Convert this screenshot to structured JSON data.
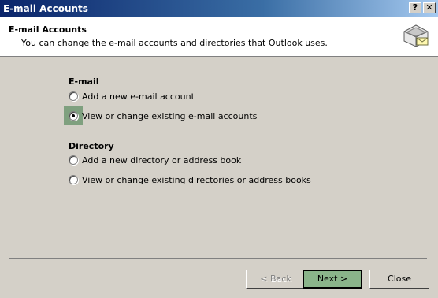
{
  "window": {
    "title": "E-mail Accounts",
    "help_label": "?",
    "close_label": "✕"
  },
  "header": {
    "title": "E-mail Accounts",
    "description": "You can change the e-mail accounts and directories that Outlook uses."
  },
  "email_group": {
    "title": "E-mail",
    "options": [
      {
        "label": "Add a new e-mail account",
        "checked": false
      },
      {
        "label": "View or change existing e-mail accounts",
        "checked": true
      }
    ]
  },
  "directory_group": {
    "title": "Directory",
    "options": [
      {
        "label": "Add a new directory or address book",
        "checked": false
      },
      {
        "label": "View or change existing directories or address books",
        "checked": false
      }
    ]
  },
  "buttons": {
    "back": "< Back",
    "next": "Next >",
    "close": "Close"
  },
  "colors": {
    "title_start": "#0a246a",
    "title_end": "#a6caf0",
    "face": "#d4d0c8",
    "highlight": "#8ab48a"
  },
  "icons": {
    "header": "mailbox-envelope-icon"
  }
}
